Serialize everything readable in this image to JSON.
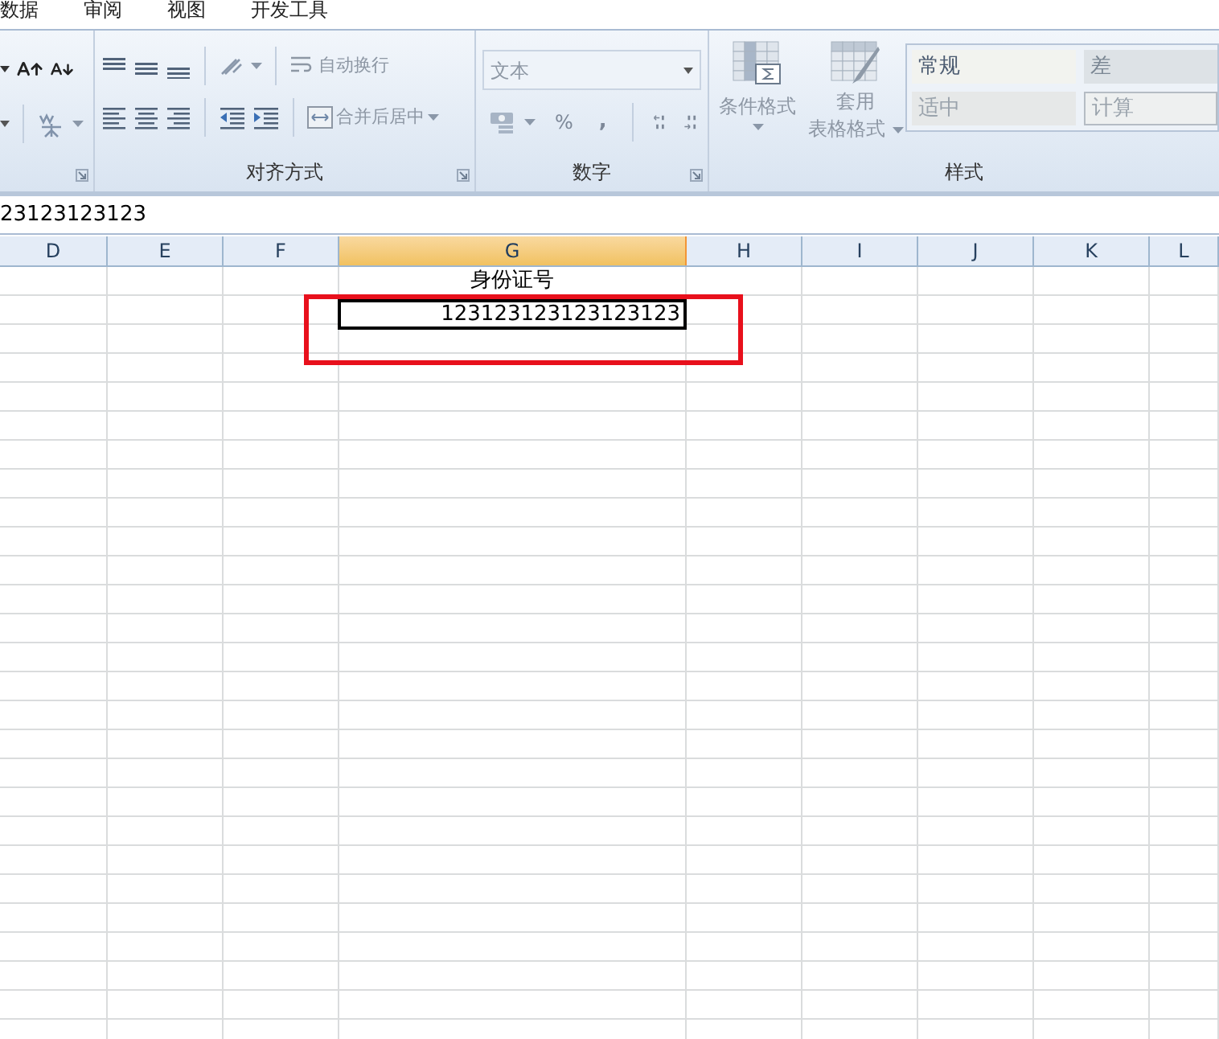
{
  "menu_tabs": [
    {
      "label": "数据",
      "selected": false
    },
    {
      "label": "审阅",
      "selected": false
    },
    {
      "label": "视图",
      "selected": false
    },
    {
      "label": "开发工具",
      "selected": false
    }
  ],
  "ribbon": {
    "alignment_group": {
      "label": "对齐方式",
      "wrap_text": "自动换行",
      "merge_center": "合并后居中"
    },
    "number_group": {
      "label": "数字",
      "format": "文本",
      "percent": "%",
      "comma": ","
    },
    "styles_group": {
      "label": "样式",
      "conditional_format": "条件格式",
      "table_format": [
        "套用",
        "表格格式"
      ],
      "styles": [
        {
          "label": "常规",
          "kind": "normal"
        },
        {
          "label": "差",
          "kind": "bad"
        },
        {
          "label": "适中",
          "kind": "neutral"
        },
        {
          "label": "计算",
          "kind": "calc"
        }
      ]
    }
  },
  "formula_bar": {
    "value": "23123123123"
  },
  "grid": {
    "columns": [
      {
        "label": "D",
        "selected": false
      },
      {
        "label": "E",
        "selected": false
      },
      {
        "label": "F",
        "selected": false
      },
      {
        "label": "G",
        "selected": true,
        "cells": [
          {
            "text": "身份证号",
            "kind": "text",
            "selected": false
          },
          {
            "text": "123123123123123123",
            "kind": "number",
            "selected": true
          }
        ]
      },
      {
        "label": "H",
        "selected": false
      },
      {
        "label": "I",
        "selected": false
      },
      {
        "label": "J",
        "selected": false
      },
      {
        "label": "K",
        "selected": false
      },
      {
        "label": "L",
        "selected": false
      }
    ],
    "annotation": {
      "kind": "red-rectangle"
    }
  }
}
